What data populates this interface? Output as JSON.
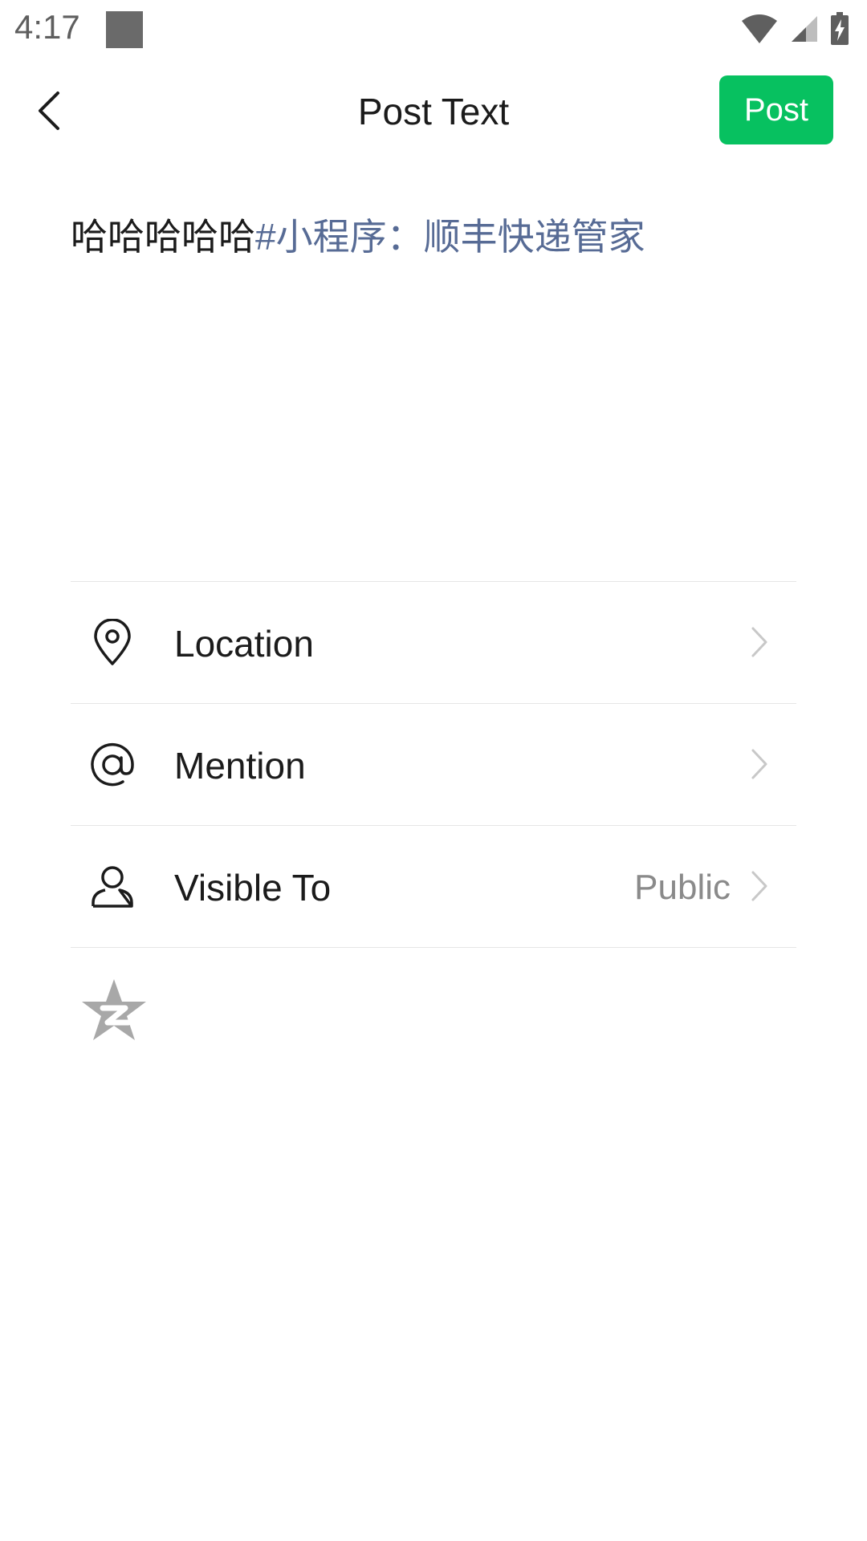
{
  "status_bar": {
    "time": "4:17",
    "icons": [
      "notification-square-icon",
      "wifi-icon",
      "signal-icon",
      "battery-charging-icon"
    ]
  },
  "header": {
    "back_icon": "chevron-left-icon",
    "title": "Post Text",
    "post_label": "Post"
  },
  "composer": {
    "plain_text": "哈哈哈哈哈",
    "tag_text": "#小程序：顺丰快递管家"
  },
  "options": {
    "location": {
      "label": "Location",
      "icon": "location-pin-icon"
    },
    "mention": {
      "label": "Mention",
      "icon": "at-icon"
    },
    "visible_to": {
      "label": "Visible To",
      "value": "Public",
      "icon": "person-icon"
    }
  },
  "share": {
    "icon": "qzone-icon"
  },
  "colors": {
    "accent_green": "#07C160",
    "tag_blue": "#576B95",
    "text_primary": "#1B1B1B",
    "text_secondary": "#8A8A8A",
    "divider": "#E6E6E6",
    "qzone_gray": "#A8A8A8"
  }
}
